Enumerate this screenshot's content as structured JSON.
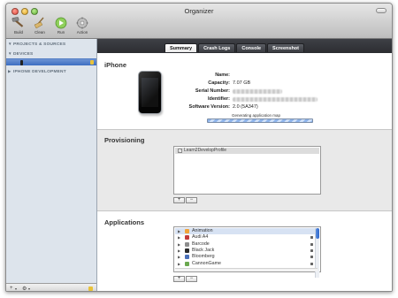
{
  "window": {
    "title": "Organizer"
  },
  "toolbar": {
    "build_label": "Build",
    "clean_label": "Clean",
    "run_label": "Run",
    "action_label": "Action"
  },
  "sidebar": {
    "projects_header": "PROJECTS & SOURCES",
    "devices_header": "DEVICES",
    "iphone_dev_header": "IPHONE DEVELOPMENT",
    "footer_add": "+",
    "footer_gear": "⚙"
  },
  "tabs": [
    "Summary",
    "Crash Logs",
    "Console",
    "Screenshot"
  ],
  "device": {
    "section_title": "iPhone",
    "name_label": "Name:",
    "name_value": "",
    "capacity_label": "Capacity:",
    "capacity_value": "7.07 GB",
    "serial_label": "Serial Number:",
    "identifier_label": "Identifier:",
    "software_label": "Software Version:",
    "software_value": "2.0 (5A347)",
    "progress_text": "Generating application map",
    "progress_fraction": 1.0
  },
  "provisioning": {
    "section_title": "Provisioning",
    "profiles": [
      {
        "name": "Learn2DevelopProfile",
        "checked": true
      }
    ],
    "add_label": "+",
    "remove_label": "−"
  },
  "applications": {
    "section_title": "Applications",
    "items": [
      {
        "name": "Animation",
        "selected": true,
        "color": "#f1a33a",
        "locked": false
      },
      {
        "name": "Audi A4",
        "selected": false,
        "color": "#c33b3b",
        "locked": true
      },
      {
        "name": "Barcode",
        "selected": false,
        "color": "#8d8d8d",
        "locked": true
      },
      {
        "name": "Black Jack",
        "selected": false,
        "color": "#2b2b2b",
        "locked": true
      },
      {
        "name": "Bloomberg",
        "selected": false,
        "color": "#4a6fb8",
        "locked": true
      },
      {
        "name": "CannonGame",
        "selected": false,
        "color": "#6aa84f",
        "locked": true
      }
    ],
    "add_label": "+",
    "remove_label": "−"
  }
}
